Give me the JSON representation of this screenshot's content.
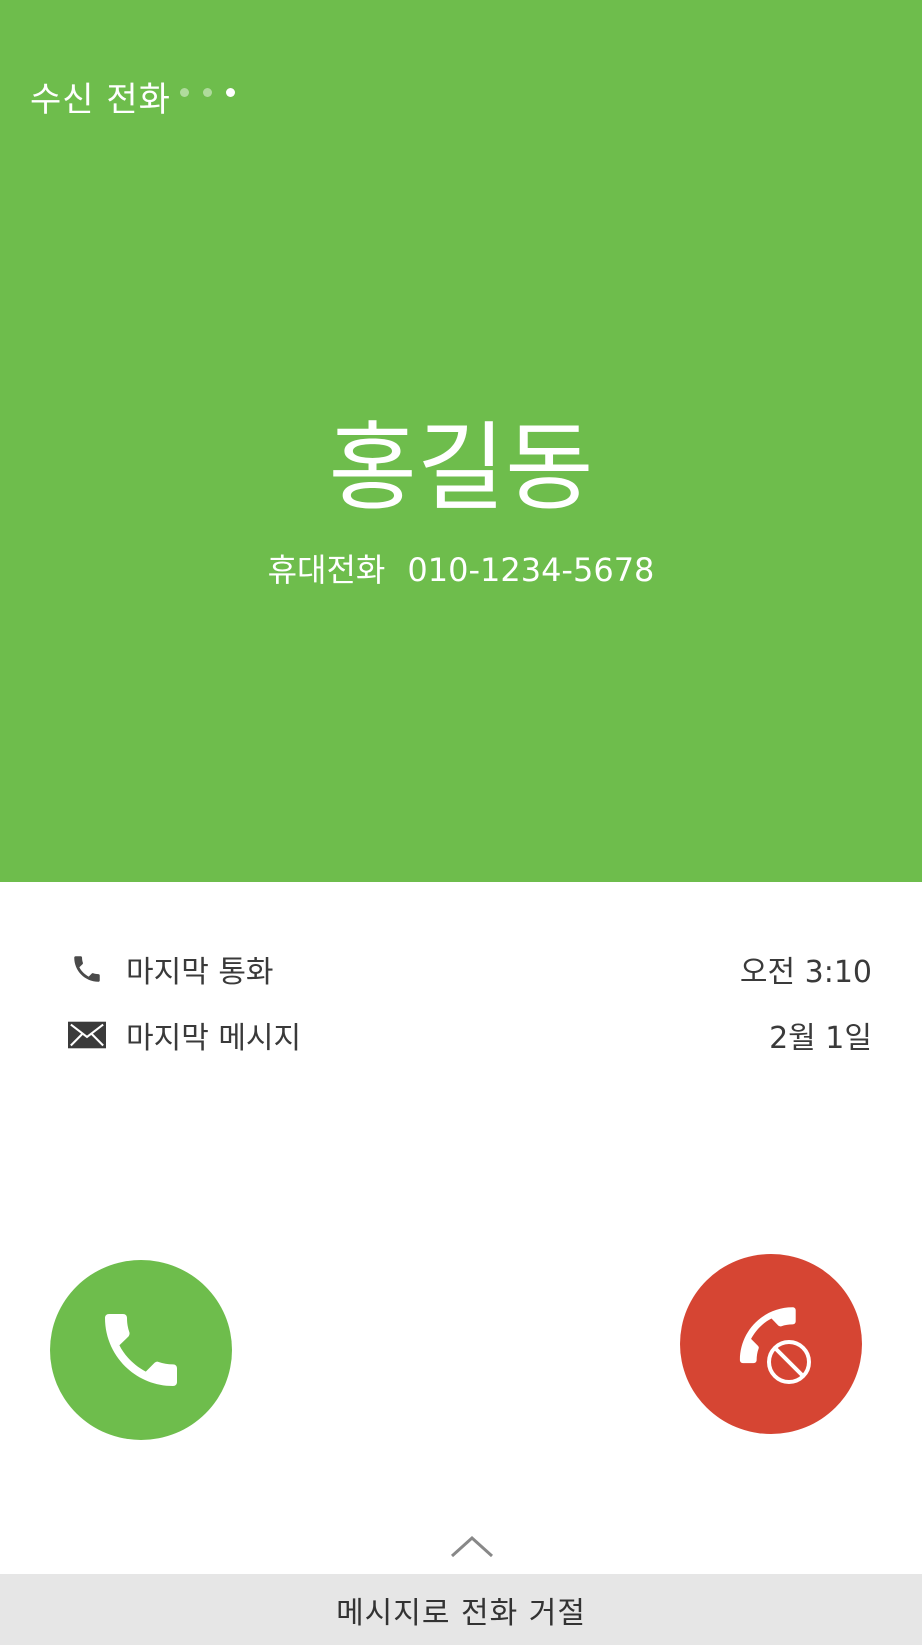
{
  "header": {
    "status_title": "수신 전화",
    "page_dots": 3,
    "active_dot": 3,
    "background_color": "#6ebd4c"
  },
  "caller": {
    "name": "홍길동",
    "number_type": "휴대전화",
    "number": "010-1234-5678"
  },
  "info": {
    "last_call": {
      "icon": "phone-icon",
      "label": "마지막 통화",
      "value": "오전 3:10"
    },
    "last_message": {
      "icon": "envelope-icon",
      "label": "마지막 메시지",
      "value": "2월 1일"
    }
  },
  "actions": {
    "accept": {
      "icon": "phone-icon",
      "color": "#6ebd4c"
    },
    "reject": {
      "icon": "phone-decline-icon",
      "color": "#d64533"
    }
  },
  "bottom": {
    "chevron_icon": "chevron-up-icon",
    "reject_with_message_label": "메시지로 전화 거절"
  }
}
